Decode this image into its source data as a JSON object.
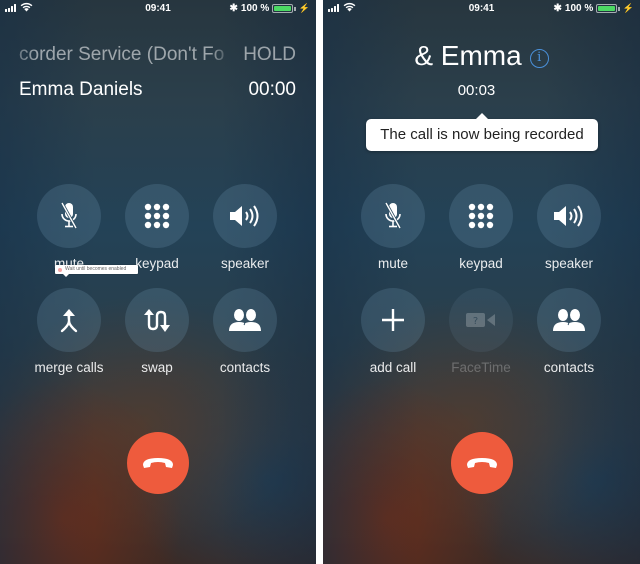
{
  "status_bar": {
    "time": "09:41",
    "battery_percent": "100 %",
    "battery_level": 1.0,
    "bluetooth_icon": "bluetooth-icon",
    "charging_icon": "bolt-icon",
    "signal_icon": "signal-bars-icon",
    "wifi_icon": "wifi-icon"
  },
  "left_screen": {
    "held_call": {
      "name": "corder Service (Don't Fo",
      "status": "HOLD"
    },
    "active_call": {
      "name": "Emma Daniels",
      "duration": "00:00"
    },
    "buttons": [
      {
        "label": "mute",
        "icon": "mic-off-icon"
      },
      {
        "label": "keypad",
        "icon": "keypad-icon"
      },
      {
        "label": "speaker",
        "icon": "speaker-icon"
      },
      {
        "label": "merge calls",
        "icon": "merge-icon"
      },
      {
        "label": "swap",
        "icon": "swap-icon"
      },
      {
        "label": "contacts",
        "icon": "contacts-icon"
      }
    ],
    "overlay_tooltip": "Wait until becomes enabled",
    "end_call_icon": "end-call-icon"
  },
  "right_screen": {
    "caller_name": "& Emma",
    "info_icon": "info-icon",
    "duration": "00:03",
    "recording_tooltip": "The call is now being recorded",
    "buttons": [
      {
        "label": "mute",
        "icon": "mic-off-icon",
        "enabled": true
      },
      {
        "label": "keypad",
        "icon": "keypad-icon",
        "enabled": true
      },
      {
        "label": "speaker",
        "icon": "speaker-icon",
        "enabled": true
      },
      {
        "label": "add call",
        "icon": "plus-icon",
        "enabled": true
      },
      {
        "label": "FaceTime",
        "icon": "facetime-icon",
        "enabled": false
      },
      {
        "label": "contacts",
        "icon": "contacts-icon",
        "enabled": true
      }
    ],
    "end_call_icon": "end-call-icon"
  },
  "colors": {
    "end_call": "#ee5b3d",
    "info_accent": "#4a90d9",
    "battery": "#4cd964"
  }
}
